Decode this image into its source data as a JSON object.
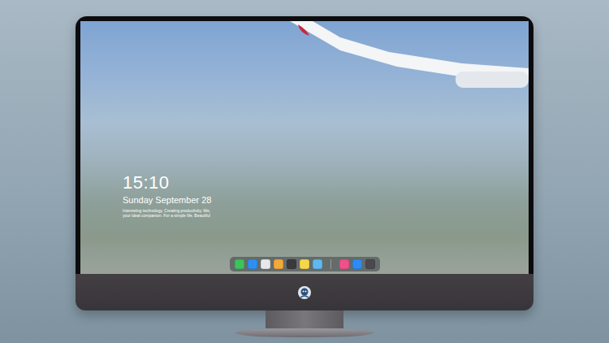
{
  "lock_screen": {
    "time": "15:10",
    "date": "Sunday September 28",
    "caption": [
      "Interesting technology. Creating productivity. We,",
      "your ideal companion. For a simple life. Beautiful"
    ]
  },
  "dock": {
    "items": [
      {
        "kind": "app",
        "color": "#3cc45a"
      },
      {
        "kind": "app",
        "color": "#2f8ff0"
      },
      {
        "kind": "app",
        "color": "#e8e8ea"
      },
      {
        "kind": "app",
        "color": "#f2a93b"
      },
      {
        "kind": "app",
        "color": "#3a3a3c"
      },
      {
        "kind": "app",
        "color": "#f7d64a"
      },
      {
        "kind": "app",
        "color": "#5fb8f0"
      },
      {
        "kind": "separator",
        "color": "#9a9a9a"
      },
      {
        "kind": "app",
        "color": "#f0508a"
      },
      {
        "kind": "app",
        "color": "#2c8cf2"
      },
      {
        "kind": "app",
        "color": "#4a4a4e"
      }
    ]
  }
}
